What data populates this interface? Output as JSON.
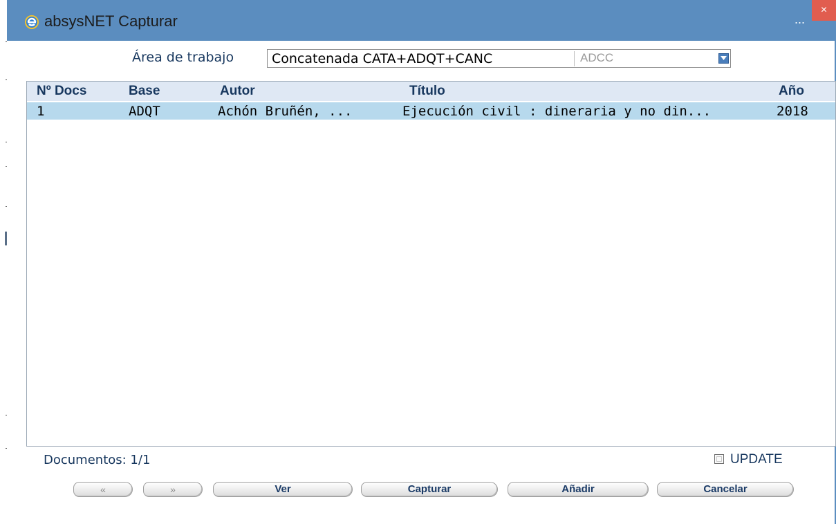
{
  "window": {
    "title": "absysNET Capturar",
    "overflow_dots": "...",
    "close_glyph": "×"
  },
  "workspace": {
    "label": "Área de trabajo",
    "value": "Concatenada CATA+ADQT+CANC",
    "code": "ADCC"
  },
  "table": {
    "columns": [
      "Nº Docs",
      "Base",
      "Autor",
      "Título",
      "Año"
    ],
    "rows": [
      {
        "ndocs": "1",
        "base": "ADQT",
        "autor": "Achón Bruñén, ...",
        "titulo": "Ejecución civil : dineraria y no din...",
        "anio": "2018"
      }
    ]
  },
  "footer": {
    "documents": "Documentos: 1/1",
    "update_label": "UPDATE",
    "update_checked": false
  },
  "buttons": {
    "prev": "«",
    "next": "»",
    "ver": "Ver",
    "capturar": "Capturar",
    "anadir": "Añadir",
    "cancelar": "Cancelar"
  },
  "colors": {
    "titlebar": "#5b8dbf",
    "header_bg": "#dfe8f4",
    "selected_row": "#b7d9ed",
    "label_text": "#17375e",
    "close": "#e15d4f"
  },
  "icons": {
    "app": "ie-browser-icon",
    "dropdown": "chevron-down-icon",
    "close": "close-icon"
  }
}
